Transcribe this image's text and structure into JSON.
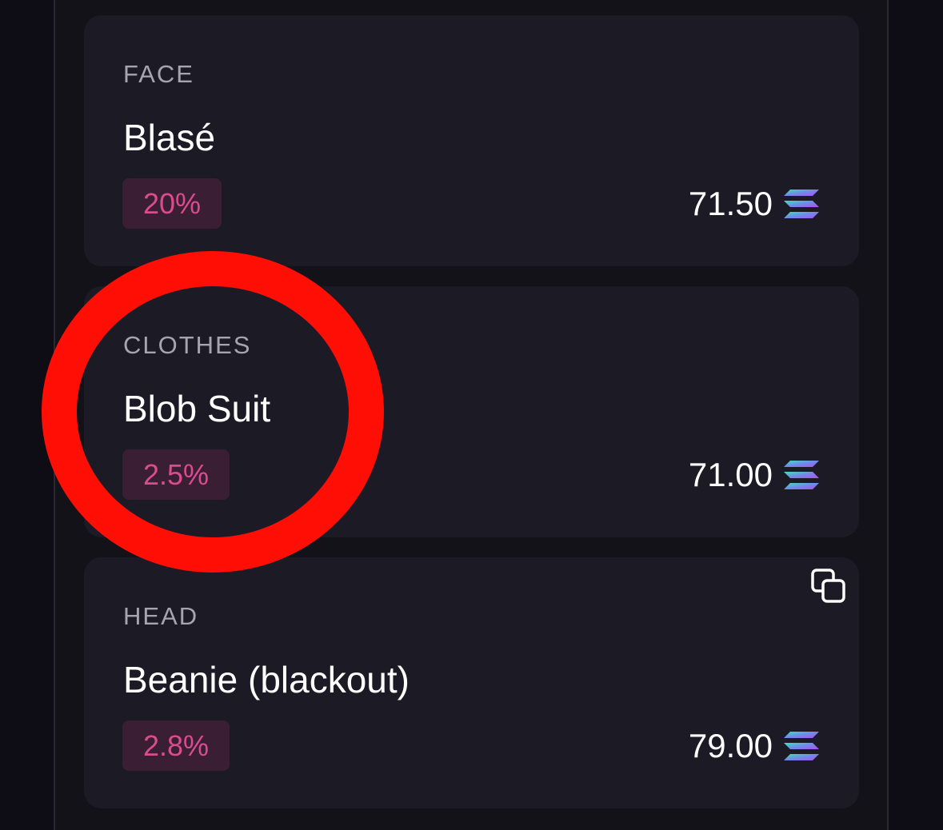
{
  "traits": [
    {
      "type": "FACE",
      "value": "Blasé",
      "rarity": "20%",
      "price": "71.50",
      "price_icon": "solana-icon"
    },
    {
      "type": "CLOTHES",
      "value": "Blob Suit",
      "rarity": "2.5%",
      "price": "71.00",
      "price_icon": "solana-icon"
    },
    {
      "type": "HEAD",
      "value": "Beanie (blackout)",
      "rarity": "2.8%",
      "price": "79.00",
      "price_icon": "solana-icon",
      "action_icon": "copy-icon"
    }
  ],
  "colors": {
    "background": "#0e0c14",
    "card": "#1c1a25",
    "badge_bg": "#3a1e34",
    "badge_text": "#d94c8e",
    "highlight": "#ff0e06"
  }
}
